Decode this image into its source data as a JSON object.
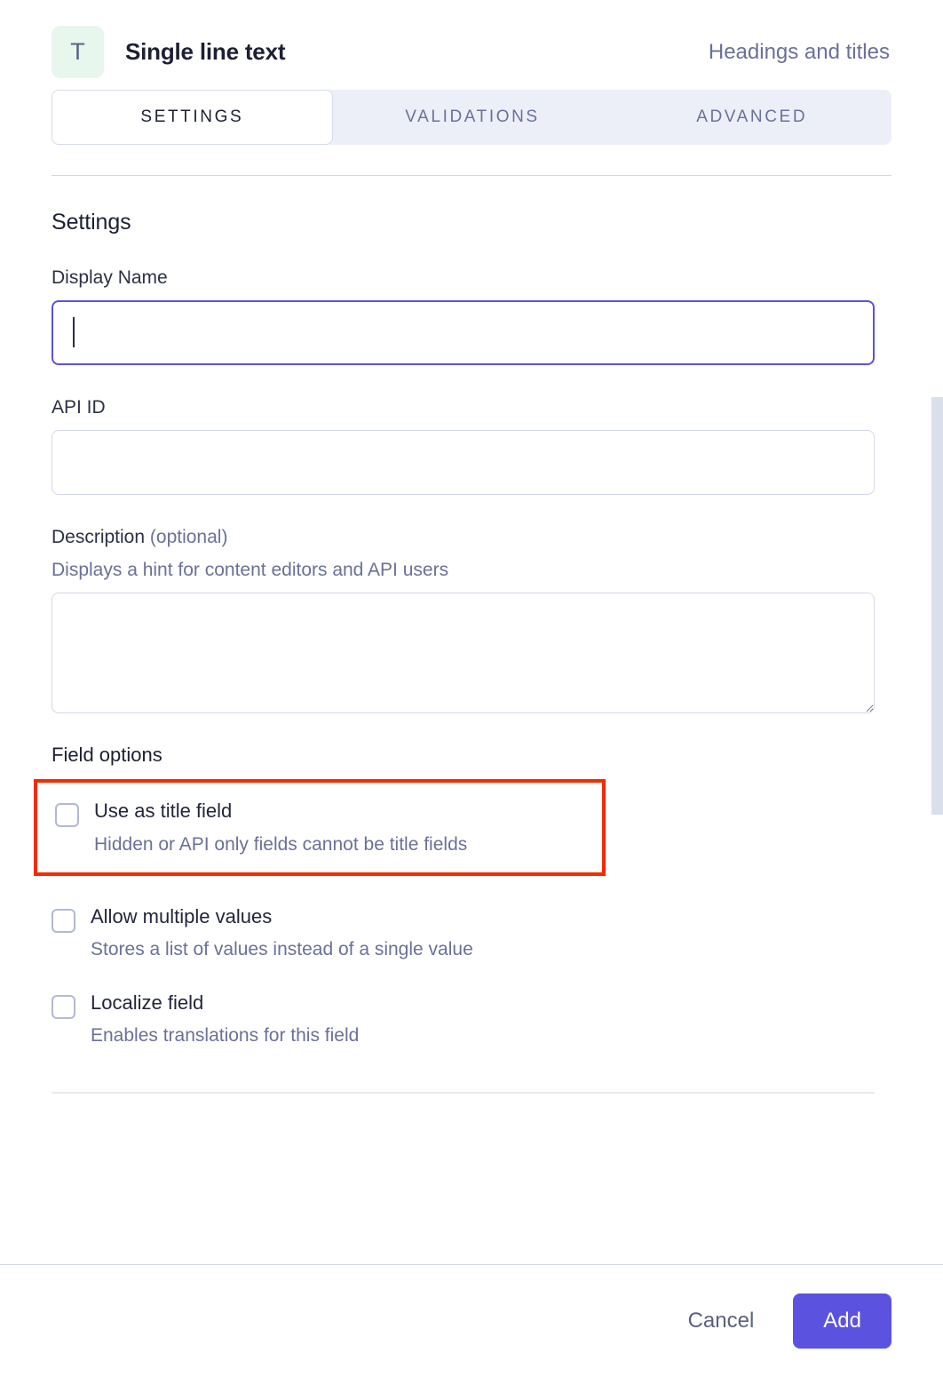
{
  "header": {
    "badge_icon": "text-type-icon",
    "badge_glyph": "T",
    "title": "Single line text",
    "group_label": "Headings and titles",
    "badge_color": "#e7f7ed"
  },
  "tabs": [
    {
      "label": "SETTINGS",
      "active": true
    },
    {
      "label": "VALIDATIONS",
      "active": false
    },
    {
      "label": "ADVANCED",
      "active": false
    }
  ],
  "settings": {
    "section_title": "Settings",
    "display_name": {
      "label": "Display Name",
      "value": "",
      "placeholder": "",
      "focused": true
    },
    "api_id": {
      "label": "API ID",
      "value": "",
      "placeholder": ""
    },
    "description": {
      "label": "Description",
      "label_optional": "(optional)",
      "hint": "Displays a hint for content editors and API users",
      "value": "",
      "placeholder": ""
    },
    "field_options": {
      "title": "Field options",
      "items": [
        {
          "label": "Use as title field",
          "description": "Hidden or API only fields cannot be title fields",
          "checked": false,
          "highlighted": true
        },
        {
          "label": "Allow multiple values",
          "description": "Stores a list of values instead of a single value",
          "checked": false,
          "highlighted": false
        },
        {
          "label": "Localize field",
          "description": "Enables translations for this field",
          "checked": false,
          "highlighted": false
        }
      ]
    }
  },
  "footer": {
    "cancel_label": "Cancel",
    "add_label": "Add",
    "primary_color": "#5b52e0"
  },
  "annotation": {
    "highlight_color": "#f32b00"
  }
}
